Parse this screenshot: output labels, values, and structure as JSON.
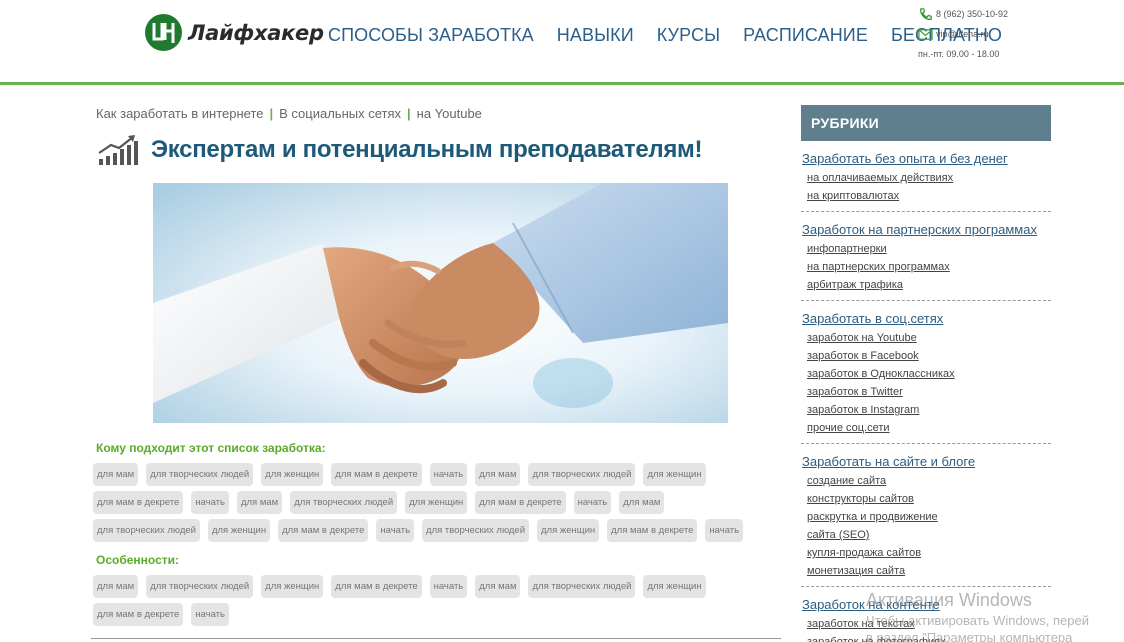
{
  "header": {
    "logo_text": "Лайфхакер",
    "nav": [
      "СПОСОБЫ ЗАРАБОТКА",
      "НАВЫКИ",
      "КУРСЫ",
      "РАСПИСАНИЕ",
      "БЕСПЛАТНО"
    ],
    "phone": "8 (962) 350-10-92",
    "email": "vip@lifeha.ru",
    "hours": "пн.-пт. 09.00 - 18.00",
    "accent_color": "#6ab04c",
    "nav_color": "#2c5f8a"
  },
  "breadcrumb": [
    "Как заработать в интернете",
    "В социальных сетях",
    "на Youtube"
  ],
  "page_title": "Экспертам и потенциальным преподавателям!",
  "suitable": {
    "label": "Кому подходит этот список заработка:",
    "tags": [
      "для мам",
      "для творческих людей",
      "для женщин",
      "для мам в декрете",
      "начать",
      "для мам",
      "для творческих людей",
      "для женщин",
      "для мам в декрете",
      "начать",
      "для мам",
      "для творческих людей",
      "для женщин",
      "для мам в декрете",
      "начать",
      "для мам",
      "для творческих людей",
      "для женщин",
      "для мам в декрете",
      "начать",
      "для творческих людей",
      "для женщин",
      "для мам в декрете",
      "начать"
    ]
  },
  "features": {
    "label": "Особенности:",
    "tags": [
      "для мам",
      "для творческих людей",
      "для женщин",
      "для мам в декрете",
      "начать",
      "для мам",
      "для творческих людей",
      "для женщин",
      "для мам в декрете",
      "начать"
    ]
  },
  "sidebar": {
    "header": "РУБРИКИ",
    "rubrics": [
      {
        "title": "Заработать без опыта и без денег",
        "items": [
          "на оплачиваемых действиях",
          "на криптовалютах"
        ]
      },
      {
        "title": "Заработок на партнерских программах",
        "items": [
          "инфопартнерки",
          "на партнерских программах",
          "арбитраж трафика"
        ]
      },
      {
        "title": "Заработать в соц.сетях",
        "items": [
          "заработок на Youtube",
          "заработок в Facebook",
          "заработок в Одноклассниках",
          "заработок в Twitter",
          "заработок в Instagram",
          "прочие соц.сети"
        ]
      },
      {
        "title": "Заработать на сайте и блоге",
        "items": [
          "создание сайта",
          "конструкторы сайтов",
          "раскрутка и продвижение",
          "сайта (SEO)",
          "купля-продажа сайтов",
          "монетизация сайта"
        ]
      },
      {
        "title": "Заработок на контенте",
        "items": [
          "заработок на текстах",
          "заработок на фотографиях"
        ]
      }
    ]
  },
  "watermark": {
    "title": "Активация Windows",
    "line1": "Чтобы активировать Windows, перей",
    "line2": "в раздел \"Параметры компьютера"
  }
}
